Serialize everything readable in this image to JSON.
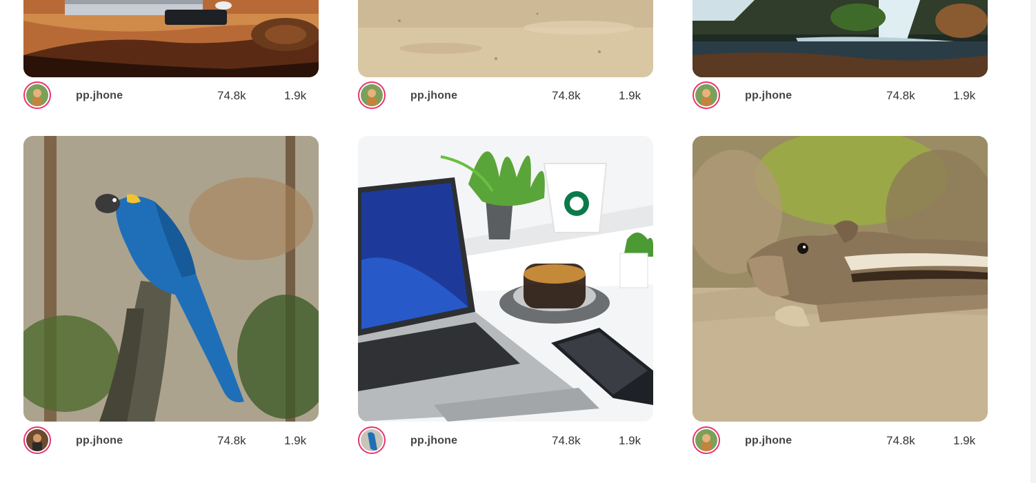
{
  "posts": [
    {
      "image": "laptop-on-wooden-table",
      "username": "pp.jhone",
      "views": "74.8k",
      "likes": "1.9k"
    },
    {
      "image": "sandy-ground",
      "username": "pp.jhone",
      "views": "74.8k",
      "likes": "1.9k"
    },
    {
      "image": "waterfall",
      "username": "pp.jhone",
      "views": "74.8k",
      "likes": "1.9k"
    },
    {
      "image": "blue-macaw-parrot",
      "username": "pp.jhone",
      "views": "74.8k",
      "likes": "1.9k"
    },
    {
      "image": "laptop-coffee-workspace",
      "username": "pp.jhone",
      "views": "74.8k",
      "likes": "1.9k"
    },
    {
      "image": "chipmunk-eating",
      "username": "pp.jhone",
      "views": "74.8k",
      "likes": "1.9k"
    }
  ],
  "colors": {
    "avatar_ring": "#e8336e",
    "text": "#333333"
  }
}
